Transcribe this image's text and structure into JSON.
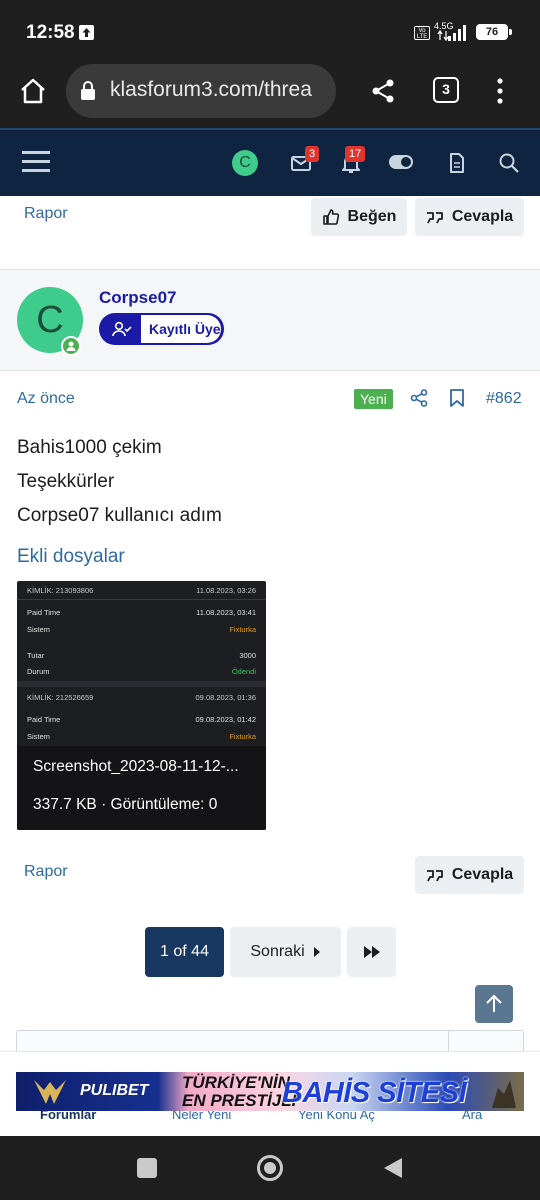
{
  "status": {
    "time": "12:58",
    "network": "4.5G",
    "volte": "Vo LTE",
    "battery": "76"
  },
  "browser": {
    "url": "klasforum3.com/threa",
    "tab_count": "3"
  },
  "header": {
    "avatar_letter": "C",
    "inbox_count": "3",
    "alerts_count": "17"
  },
  "post_prev": {
    "report_label": "Rapor",
    "like_label": "Beğen",
    "reply_label": "Cevapla"
  },
  "post": {
    "avatar_letter": "C",
    "username": "Corpse07",
    "role": "Kayıtlı Üye",
    "time": "Az önce",
    "new_badge": "Yeni",
    "post_number": "#862",
    "lines": [
      "Bahis1000 çekim",
      "Teşekkürler",
      "Corpse07 kullanıcı adım"
    ],
    "attachments_title": "Ekli dosyalar",
    "attachment": {
      "filename": "Screenshot_2023-08-11-12-...",
      "meta": "337.7 KB · Görüntüleme: 0",
      "rows": [
        {
          "left": "KİMLİK: 213093806",
          "right": "11.08.2023, 03:26"
        },
        {
          "left": "Paid Time",
          "right": "11.08.2023, 03:41"
        },
        {
          "left": "Sistem",
          "right": "Fixturka"
        },
        {
          "left": "Tutar",
          "right": "3000"
        },
        {
          "left": "Durum",
          "right": "Ödendi"
        },
        {
          "left": "KİMLİK: 212526659",
          "right": "09.08.2023, 01:36"
        },
        {
          "left": "Paid Time",
          "right": "09.08.2023, 01:42"
        },
        {
          "left": "Sistem",
          "right": "Fixturka"
        }
      ]
    },
    "report_label": "Rapor",
    "reply_label": "Cevapla"
  },
  "pagination": {
    "current": "1 of 44",
    "next_label": "Sonraki"
  },
  "bottom_nav": {
    "items": [
      "Forumlar",
      "Neler Yeni",
      "Yeni Konu Aç",
      "Ara"
    ]
  },
  "ad": {
    "brand": "PULIBET",
    "line1": "TÜRKİYE'NİN",
    "line2": "EN PRESTİJLİ",
    "line3": "BAHİS SİTESİ"
  },
  "colors": {
    "header_bg": "#0f2440",
    "link": "#2d6aa4",
    "avatar_green": "#3ecb8b",
    "new_badge": "#4caf50",
    "pagination_active": "#183861",
    "username": "#1a1aa6"
  }
}
